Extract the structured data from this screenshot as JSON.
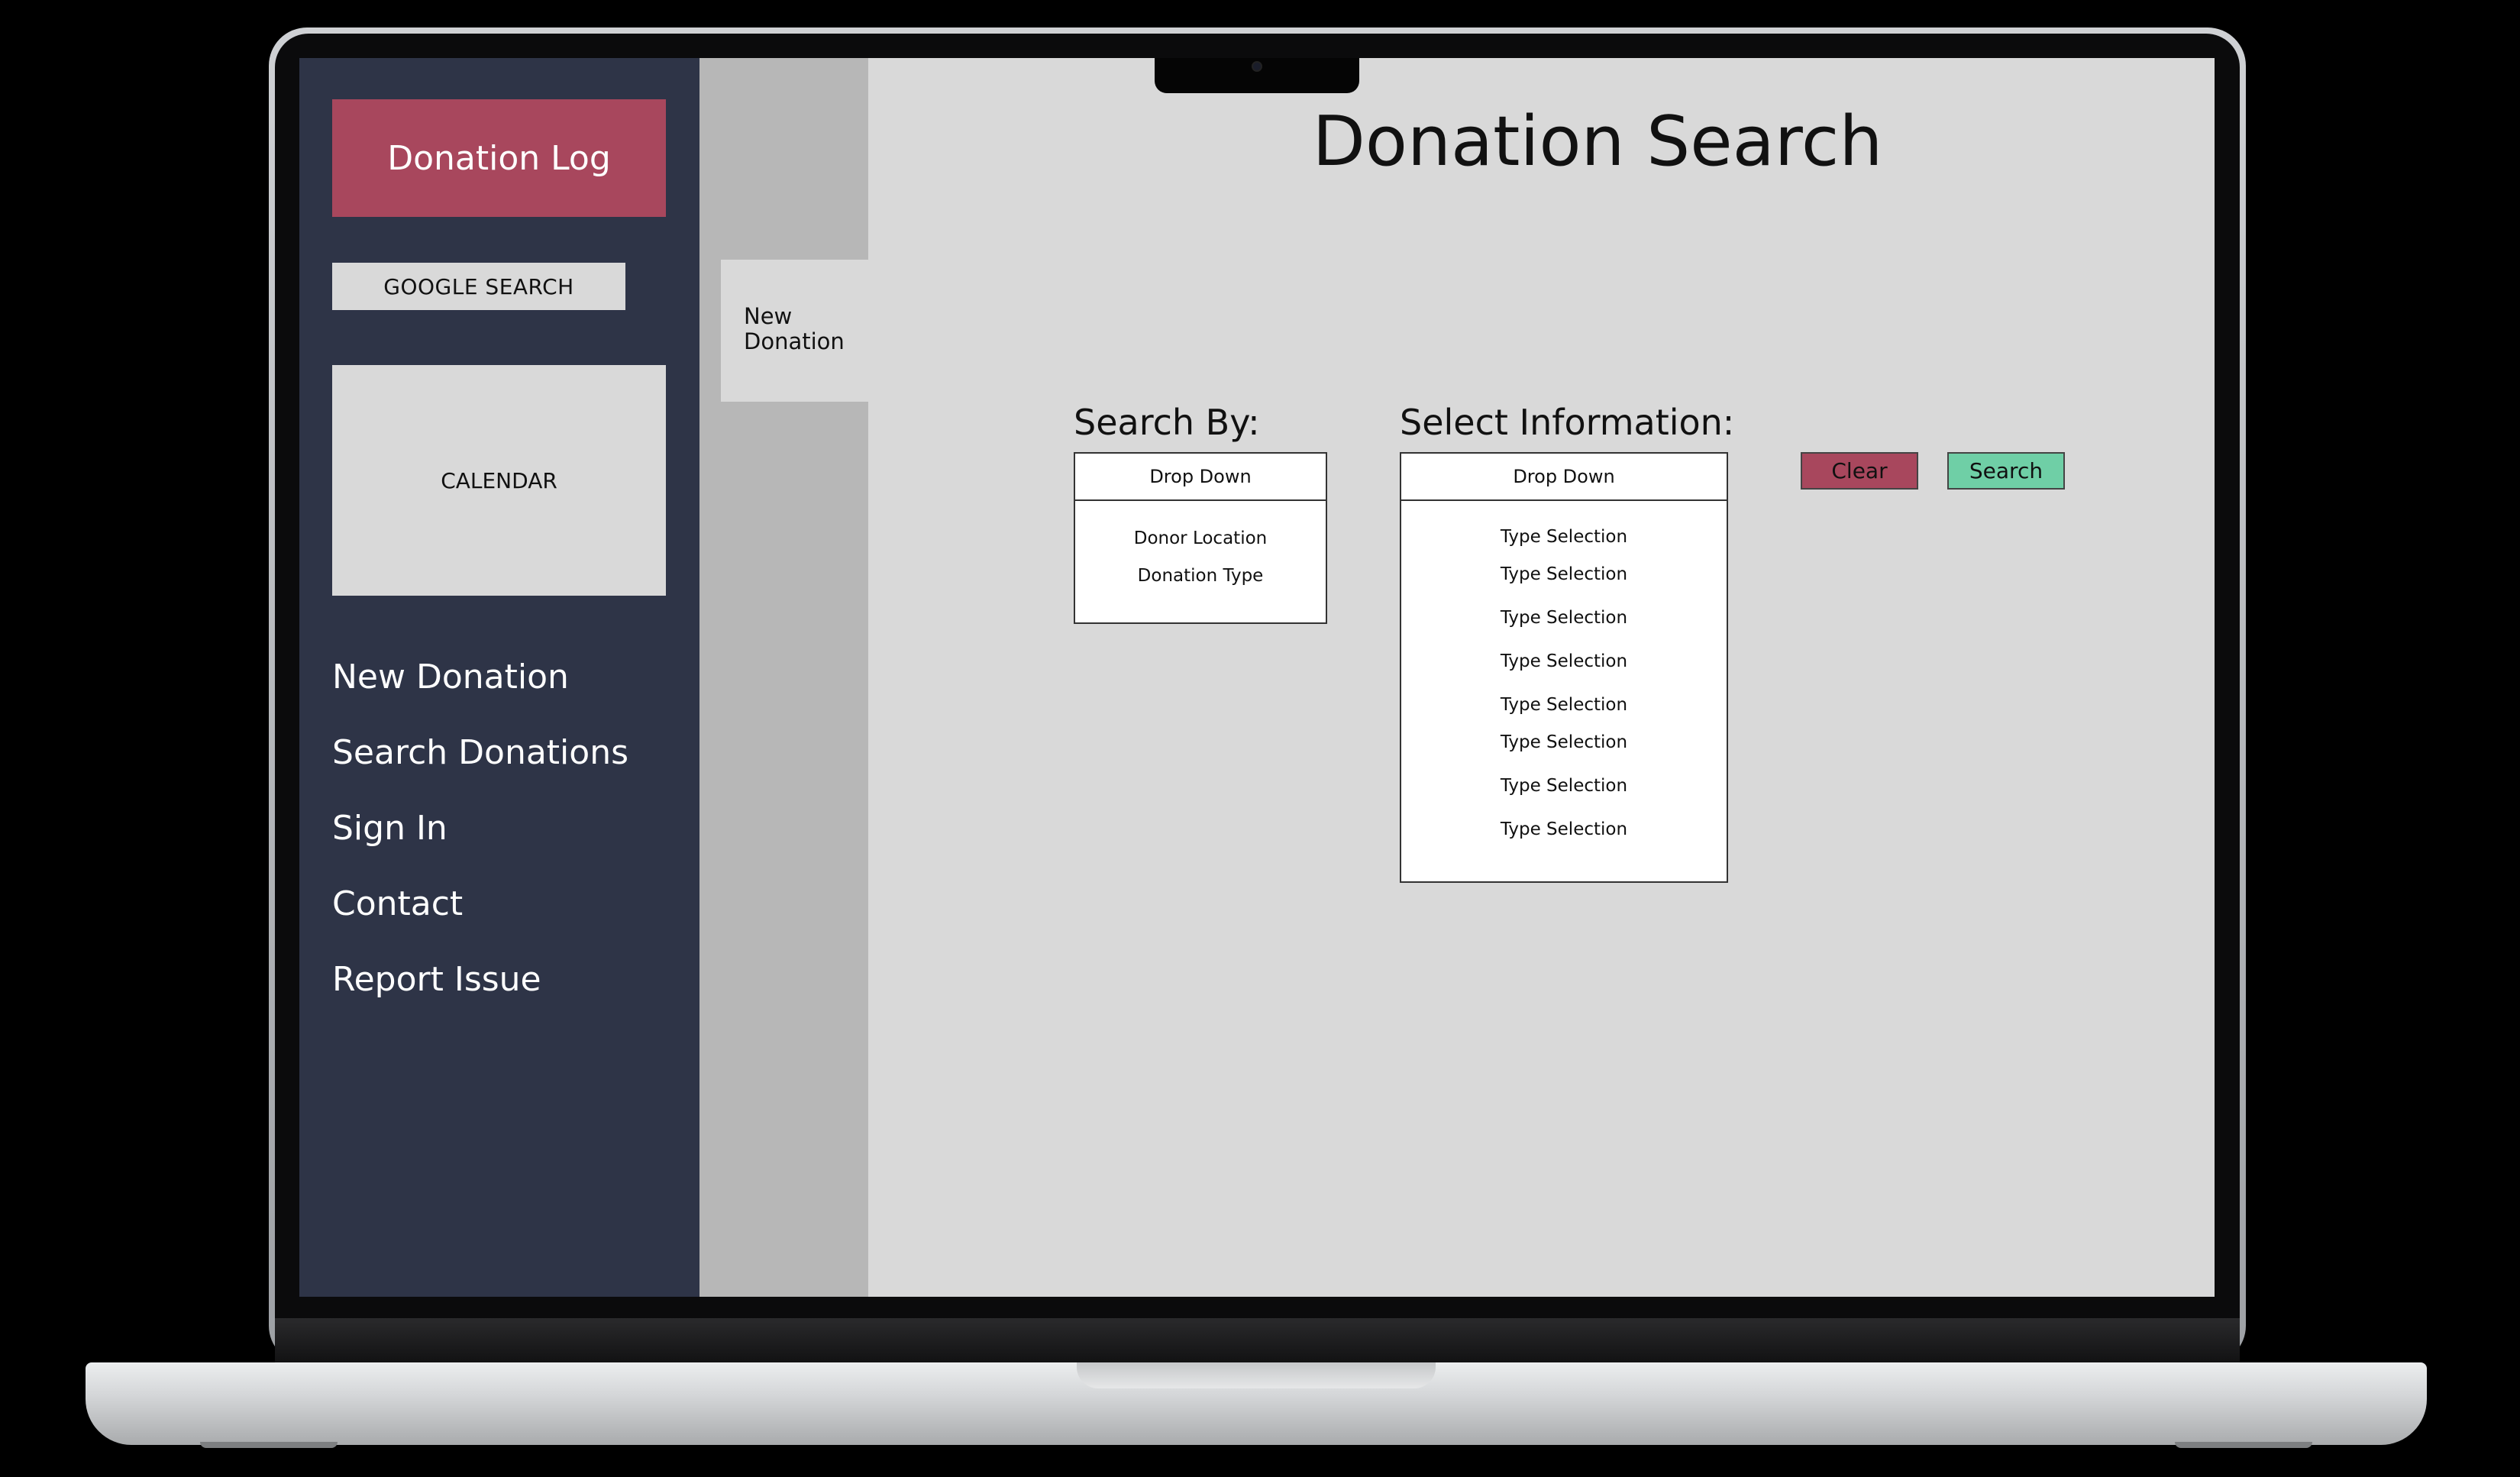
{
  "sidebar": {
    "logo_label": "Donation Log",
    "google_search_label": "GOOGLE SEARCH",
    "calendar_label": "CALENDAR",
    "nav": [
      "New Donation",
      "Search Donations",
      "Sign In",
      "Contact",
      "Report Issue"
    ]
  },
  "secondary": {
    "tab_label_line1": "New",
    "tab_label_line2": "Donation"
  },
  "main": {
    "title": "Donation Search",
    "search_by": {
      "label": "Search By:",
      "dropdown_label": "Drop Down",
      "options": [
        "Donor Location",
        "Donation Type"
      ]
    },
    "select_info": {
      "label": "Select Information:",
      "dropdown_label": "Drop Down",
      "options": [
        "Type Selection",
        "Type Selection",
        "Type Selection",
        "Type Selection",
        "Type Selection",
        "Type Selection",
        "Type Selection",
        "Type Selection"
      ]
    },
    "clear_label": "Clear",
    "search_label": "Search"
  },
  "colors": {
    "sidebar_bg": "#2e3447",
    "accent_red": "#a8475d",
    "accent_green": "#6fcfa6",
    "screen_bg": "#d9d9d9"
  }
}
